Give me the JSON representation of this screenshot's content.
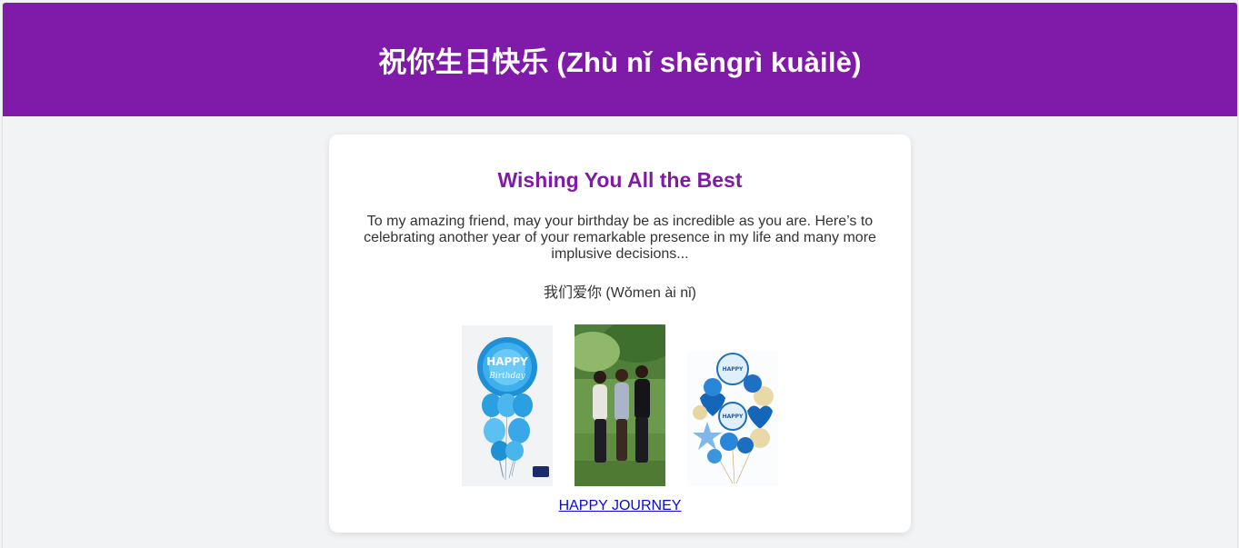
{
  "header": {
    "title": "祝你生日快乐 (Zhù nǐ shēngrì kuàilè)"
  },
  "card": {
    "heading": "Wishing You All the Best",
    "message": "To my amazing friend, may your birthday be as incredible as you are. Here’s to celebrating another year of your remarkable presence in my life and many more implusive decisions...",
    "love_line": "我们爱你 (Wǒmen ài nǐ)",
    "link_text": "HAPPY JOURNEY"
  },
  "colors": {
    "header_bg": "#801aa8",
    "heading": "#801aa8",
    "page_bg": "#f2f3f5",
    "link": "#0b0bd8"
  }
}
